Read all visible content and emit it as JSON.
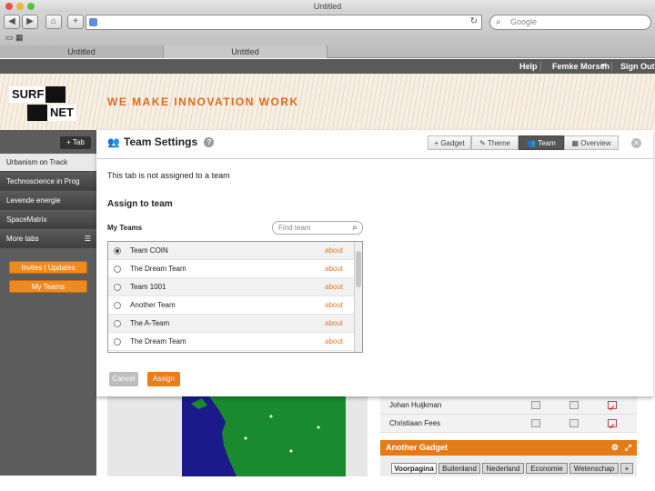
{
  "browser": {
    "window_title": "Untitled",
    "search_placeholder": "Google",
    "tabs": [
      "Untitled",
      "Untitled"
    ]
  },
  "topnav": {
    "help": "Help",
    "user": "Femke Morsch",
    "signout": "Sign Out"
  },
  "banner": {
    "logo_top_left": "SURF",
    "logo_bottom_right": "NET",
    "tagline": "WE MAKE INNOVATION WORK"
  },
  "sidebar": {
    "add_tab": "+ Tab",
    "items": [
      "Urbanism on Track",
      "Technoscience in Prog",
      "Levende energie",
      "SpaceMatrix",
      "More tabs"
    ],
    "invites": "Invites | Updates",
    "my_teams": "My Teams"
  },
  "modal": {
    "title": "Team Settings",
    "help_icon": "?",
    "toolbar": [
      "+ Gadget",
      "Theme",
      "Team",
      "Overview"
    ],
    "selected_toolbar": "Team",
    "message": "This tab is not assigned to a team",
    "assign_heading": "Assign to team",
    "my_teams_label": "My Teams",
    "find_placeholder": "Find team",
    "teams": [
      {
        "name": "Team COIN",
        "link": "about",
        "selected": true
      },
      {
        "name": "The Dream Team",
        "link": "about",
        "selected": false
      },
      {
        "name": "Team 1001",
        "link": "about",
        "selected": false
      },
      {
        "name": "Another Team",
        "link": "about",
        "selected": false
      },
      {
        "name": "The A-Team",
        "link": "about",
        "selected": false
      },
      {
        "name": "The Dream Team",
        "link": "about",
        "selected": false
      }
    ],
    "cancel": "Cancel",
    "assign": "Assign"
  },
  "background": {
    "people": [
      {
        "name": "Johan Huijkman",
        "checks": [
          false,
          false,
          true
        ]
      },
      {
        "name": "Christiaan Fees",
        "checks": [
          false,
          false,
          true
        ]
      }
    ],
    "gadget_title": "Another Gadget",
    "gadget_tabs": [
      "Voorpagina",
      "Buitenland",
      "Nederland",
      "Economie",
      "Wetenschap",
      "+"
    ],
    "selected_gadget_tab": "Voorpagina"
  },
  "colors": {
    "accent": "#e27c19",
    "sidebar": "#4a4a4a",
    "map_land": "#1a8a2e",
    "map_sea": "#1b1a8a"
  }
}
